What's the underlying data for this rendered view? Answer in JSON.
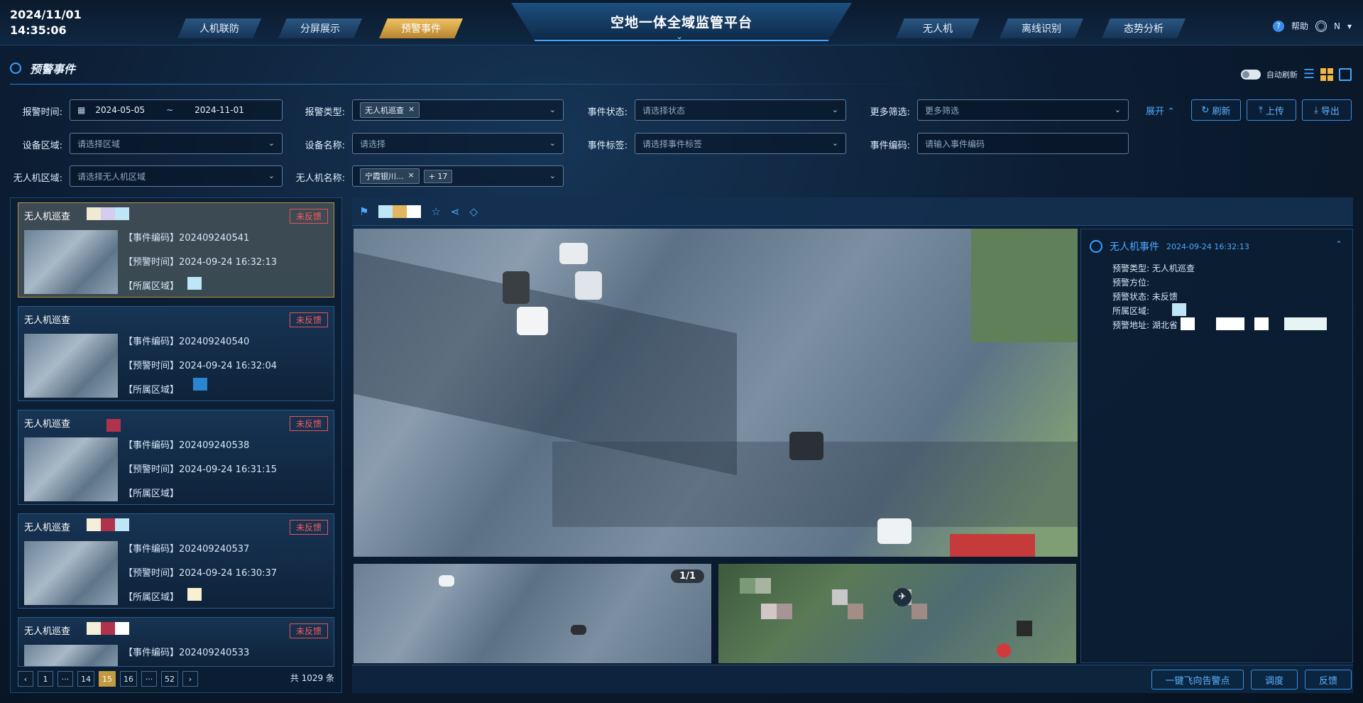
{
  "clock": {
    "date": "2024/11/01",
    "time": "14:35:06"
  },
  "nav": {
    "left": [
      "人机联防",
      "分屏展示",
      "预警事件"
    ],
    "active": "预警事件",
    "title": "空地一体全域监管平台",
    "right": [
      "无人机",
      "离线识别",
      "态势分析"
    ]
  },
  "user": {
    "help": "帮助",
    "name": "N"
  },
  "section": {
    "title": "预警事件",
    "auto_refresh": "自动刷新"
  },
  "filters": {
    "alarm_time_label": "报警时间:",
    "date_start": "2024-05-05",
    "date_sep": "~",
    "date_end": "2024-11-01",
    "alarm_type_label": "报警类型:",
    "alarm_type_tag": "无人机巡查",
    "event_status_label": "事件状态:",
    "event_status_placeholder": "请选择状态",
    "more_filter_label": "更多筛选:",
    "more_filter_placeholder": "更多筛选",
    "device_area_label": "设备区域:",
    "device_area_placeholder": "请选择区域",
    "device_name_label": "设备名称:",
    "device_name_placeholder": "请选择",
    "event_tag_label": "事件标签:",
    "event_tag_placeholder": "请选择事件标签",
    "event_code_label": "事件编码:",
    "event_code_placeholder": "请输入事件编码",
    "drone_area_label": "无人机区域:",
    "drone_area_placeholder": "请选择无人机区域",
    "drone_name_label": "无人机名称:",
    "drone_name_tag": "宁霞银川...",
    "drone_name_more": "+ 17",
    "expand": "展开",
    "refresh": "刷新",
    "upload": "上传",
    "export": "导出"
  },
  "events": [
    {
      "title": "无人机巡查",
      "status": "未反馈",
      "code_line": "【事件编码】202409240541",
      "time_line": "【预警时间】2024-09-24 16:32:13",
      "area_line": "【所属区域】"
    },
    {
      "title": "无人机巡查",
      "status": "未反馈",
      "code_line": "【事件编码】202409240540",
      "time_line": "【预警时间】2024-09-24 16:32:04",
      "area_line": "【所属区域】"
    },
    {
      "title": "无人机巡查",
      "status": "未反馈",
      "code_line": "【事件编码】202409240538",
      "time_line": "【预警时间】2024-09-24 16:31:15",
      "area_line": "【所属区域】"
    },
    {
      "title": "无人机巡查",
      "status": "未反馈",
      "code_line": "【事件编码】202409240537",
      "time_line": "【预警时间】2024-09-24 16:30:37",
      "area_line": "【所属区域】"
    },
    {
      "title": "无人机巡查",
      "status": "未反馈",
      "code_line": "【事件编码】202409240533",
      "time_line": "",
      "area_line": ""
    }
  ],
  "pager": {
    "pages": [
      "1",
      "···",
      "14",
      "15",
      "16",
      "···",
      "52"
    ],
    "current": "15",
    "total": "共 1029 条"
  },
  "viewer": {
    "counter": "1/1"
  },
  "detail": {
    "title": "无人机事件",
    "time": "2024-09-24 16:32:13",
    "rows": [
      {
        "k": "预警类型:",
        "v": "无人机巡查"
      },
      {
        "k": "预警方位:",
        "v": ""
      },
      {
        "k": "预警状态:",
        "v": "未反馈"
      },
      {
        "k": "所属区域:",
        "v": ""
      },
      {
        "k": "预警地址:",
        "v": "湖北省"
      }
    ]
  },
  "actions": {
    "fly": "一键飞向告警点",
    "dispatch": "调度",
    "feedback": "反馈"
  }
}
